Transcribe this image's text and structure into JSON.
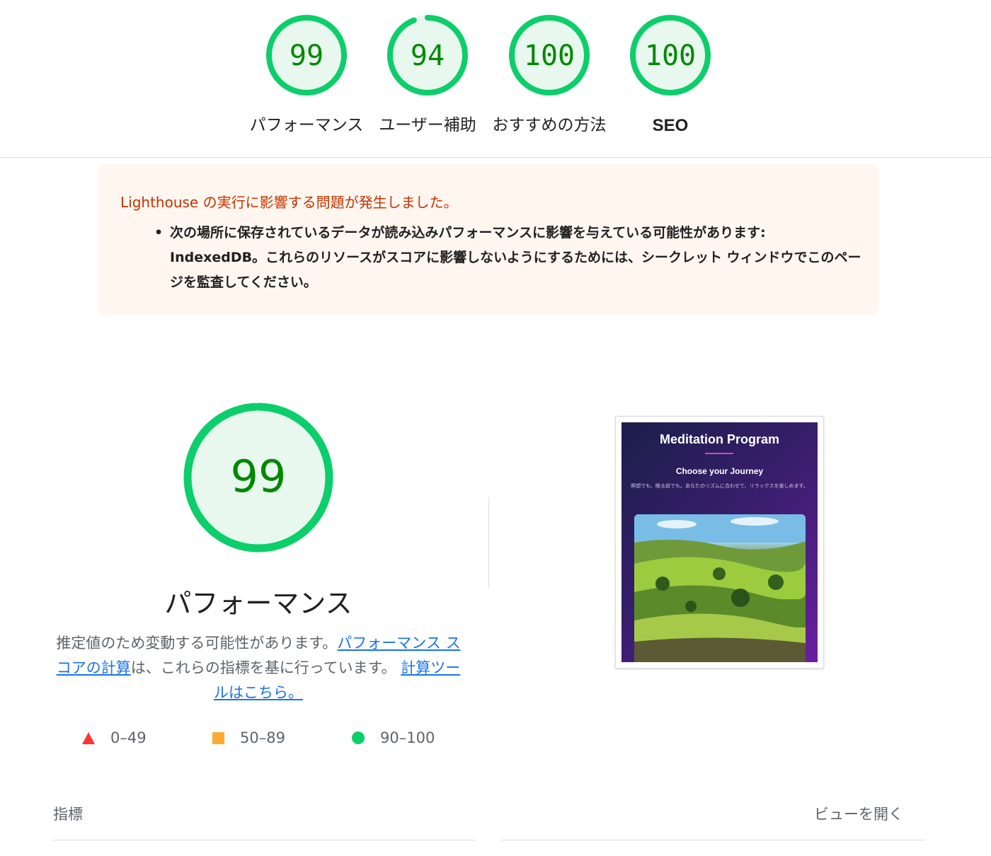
{
  "colors": {
    "pass_green": "#0cce6b",
    "pass_text": "#008800",
    "pass_fill": "#e8f8ee",
    "average_orange": "#ffaa33",
    "fail_red": "#ff3333",
    "warning_bg": "#fff6f0",
    "warning_title": "#c33300",
    "link": "#1a73e8"
  },
  "gauges": [
    {
      "score": "99",
      "score_value": 99,
      "label": "パフォーマンス"
    },
    {
      "score": "94",
      "score_value": 94,
      "label": "ユーザー補助"
    },
    {
      "score": "100",
      "score_value": 100,
      "label": "おすすめの方法"
    },
    {
      "score": "100",
      "score_value": 100,
      "label": "SEO"
    }
  ],
  "warning": {
    "title": "Lighthouse の実行に影響する問題が発生しました。",
    "items": [
      "次の場所に保存されているデータが読み込みパフォーマンスに影響を与えている可能性があります: IndexedDB。これらのリソースがスコアに影響しないようにするためには、シークレット ウィンドウでこのページを監査してください。"
    ]
  },
  "performance": {
    "score": "99",
    "score_value": 99,
    "title": "パフォーマンス",
    "desc_part1": "推定値のため変動する可能性があります。",
    "link1": "パフォーマンス スコアの計算",
    "desc_part2": "は、これらの指標を基に行っています。",
    "link2": "計算ツールはこちら。"
  },
  "legend": [
    {
      "range": "0–49",
      "icon": "triangle-icon"
    },
    {
      "range": "50–89",
      "icon": "square-icon"
    },
    {
      "range": "90–100",
      "icon": "circle-icon"
    }
  ],
  "screenshot": {
    "title": "Meditation Program",
    "subtitle": "Choose your Journey",
    "text": "瞑想でも、眠る前でも。あなたのリズムに合わせて、リラックスを楽しめます。",
    "arrow_left": "‹",
    "arrow_right": "›"
  },
  "metrics": {
    "label": "指標",
    "view_toggle": "ビューを開く"
  }
}
